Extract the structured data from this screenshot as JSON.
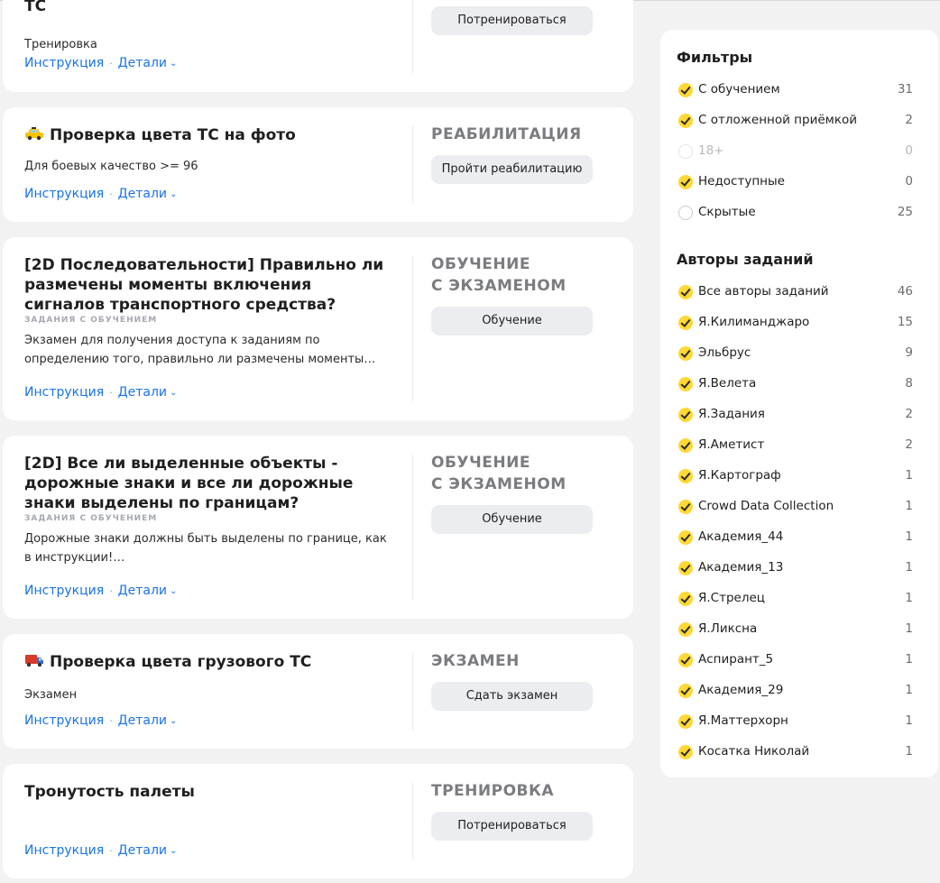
{
  "tasks": [
    {
      "title": "ТС",
      "badge": "",
      "description": "Тренировка",
      "status": "",
      "button": "Потренироваться"
    },
    {
      "title": "Проверка цвета ТС на фото",
      "icon": "taxi-icon",
      "badge": "",
      "description": "Для боевых качество >= 96",
      "status": "РЕАБИЛИТАЦИЯ",
      "button": "Пройти реабилитацию"
    },
    {
      "title": "[2D Последовательности] Правильно ли размечены моменты включения сигналов транспортного средства?",
      "badge": "ЗАДАНИЯ С ОБУЧЕНИЕМ",
      "description": "Экзамен для получения доступа к заданиям по определению того, правильно ли размечены моменты…",
      "status_line1": "ОБУЧЕНИЕ",
      "status_line2": "С ЭКЗАМЕНОМ",
      "button": "Обучение"
    },
    {
      "title": "[2D] Все ли выделенные объекты - дорожные знаки и все ли дорожные знаки выделены по границам?",
      "badge": "ЗАДАНИЯ С ОБУЧЕНИЕМ",
      "description": "Дорожные знаки должны быть выделены по границе, как в инструкции!…",
      "status_line1": "ОБУЧЕНИЕ",
      "status_line2": "С ЭКЗАМЕНОМ",
      "button": "Обучение"
    },
    {
      "title": "Проверка цвета грузового ТС",
      "icon": "truck-icon",
      "badge": "",
      "description": "Экзамен",
      "status": "ЭКЗАМЕН",
      "button": "Сдать экзамен"
    },
    {
      "title": "Тронутость палеты",
      "badge": "",
      "description": "",
      "status": "ТРЕНИРОВКА",
      "button": "Потренироваться"
    }
  ],
  "links": {
    "instruction": "Инструкция",
    "details": "Детали",
    "separator": "·"
  },
  "filters": {
    "heading": "Фильтры",
    "items": [
      {
        "label": "С обучением",
        "count": "31",
        "checked": true
      },
      {
        "label": "С отложенной приёмкой",
        "count": "2",
        "checked": true
      },
      {
        "label": "18+",
        "count": "0",
        "checked": false,
        "disabled": true
      },
      {
        "label": "Недоступные",
        "count": "0",
        "checked": true
      },
      {
        "label": "Скрытые",
        "count": "25",
        "checked": false
      }
    ]
  },
  "authors": {
    "heading": "Авторы заданий",
    "items": [
      {
        "label": "Все авторы заданий",
        "count": "46"
      },
      {
        "label": "Я.Килиманджаро",
        "count": "15"
      },
      {
        "label": "Эльбрус",
        "count": "9"
      },
      {
        "label": "Я.Велета",
        "count": "8"
      },
      {
        "label": "Я.Задания",
        "count": "2"
      },
      {
        "label": "Я.Аметист",
        "count": "2"
      },
      {
        "label": "Я.Картограф",
        "count": "1"
      },
      {
        "label": "Crowd Data Collection",
        "count": "1"
      },
      {
        "label": "Академия_44",
        "count": "1"
      },
      {
        "label": "Академия_13",
        "count": "1"
      },
      {
        "label": "Я.Стрелец",
        "count": "1"
      },
      {
        "label": "Я.Ликсна",
        "count": "1"
      },
      {
        "label": "Аспирант_5",
        "count": "1"
      },
      {
        "label": "Академия_29",
        "count": "1"
      },
      {
        "label": "Я.Маттерхорн",
        "count": "1"
      },
      {
        "label": "Косатка Николай",
        "count": "1"
      }
    ]
  },
  "colors": {
    "accent": "#ffd836",
    "link": "#1a73e8",
    "status": "#7a7c80"
  }
}
